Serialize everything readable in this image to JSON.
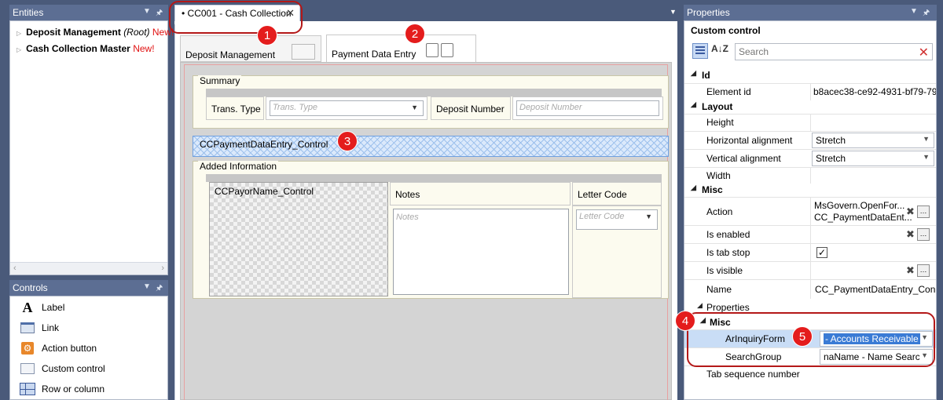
{
  "entities_panel": {
    "title": "Entities",
    "items": [
      {
        "name": "Deposit Management",
        "root": "(Root)",
        "new": "New!"
      },
      {
        "name": "Cash Collection Master",
        "root": "",
        "new": "New!"
      }
    ]
  },
  "controls_panel": {
    "title": "Controls",
    "items": [
      {
        "label": "Label",
        "icon": "label-icon"
      },
      {
        "label": "Link",
        "icon": "link-icon"
      },
      {
        "label": "Action button",
        "icon": "action-button-icon"
      },
      {
        "label": "Custom control",
        "icon": "custom-control-icon"
      },
      {
        "label": "Row or column",
        "icon": "row-column-icon"
      }
    ]
  },
  "document": {
    "tab_marker": "•",
    "tab_title": "CC001 - Cash Collection",
    "close_glyph": "✕"
  },
  "designer": {
    "tabs": [
      "Deposit Management",
      "Payment Data Entry"
    ],
    "summary_group": {
      "label": "Summary",
      "trans_type_label": "Trans. Type",
      "trans_type_placeholder": "Trans. Type",
      "deposit_number_label": "Deposit Number",
      "deposit_number_placeholder": "Deposit Number"
    },
    "payment_control_label": "CCPaymentDataEntry_Control",
    "added_info_group": {
      "label": "Added Information",
      "payor_control_label": "CCPayorName_Control",
      "notes_label": "Notes",
      "notes_placeholder": "Notes",
      "letter_code_label": "Letter Code",
      "letter_code_placeholder": "Letter Code"
    }
  },
  "properties_panel": {
    "title": "Properties",
    "subtitle": "Custom control",
    "search_placeholder": "Search",
    "sort_glyph": "A↓Z",
    "categories": {
      "id": "Id",
      "layout": "Layout",
      "misc": "Misc",
      "properties": "Properties",
      "misc2": "Misc"
    },
    "rows": {
      "element_id": {
        "name": "Element id",
        "value": "b8acec38-ce92-4931-bf79-79"
      },
      "height": {
        "name": "Height",
        "value": ""
      },
      "horizontal_alignment": {
        "name": "Horizontal alignment",
        "value": "Stretch"
      },
      "vertical_alignment": {
        "name": "Vertical alignment",
        "value": "Stretch"
      },
      "width": {
        "name": "Width",
        "value": ""
      },
      "action": {
        "name": "Action",
        "value_line1": "MsGovern.OpenFor...",
        "value_line2": "CC_PaymentDataEnt..."
      },
      "is_enabled": {
        "name": "Is enabled"
      },
      "is_tab_stop": {
        "name": "Is tab stop",
        "checked": true
      },
      "is_visible": {
        "name": "Is visible"
      },
      "name": {
        "name": "Name",
        "value": "CC_PaymentDataEntry_Con"
      },
      "ar_inquiry_form": {
        "name": "ArInquiryForm",
        "value": "- Accounts Receivable"
      },
      "search_group": {
        "name": "SearchGroup",
        "value": "naName - Name Searc"
      },
      "tab_sequence_number": {
        "name": "Tab sequence number"
      }
    }
  },
  "callouts": [
    "1",
    "2",
    "3",
    "4",
    "5"
  ],
  "colors": {
    "panel_header": "#5c6e93",
    "callout_red": "#e41c1c",
    "selection_blue": "#3a7bd5",
    "new_red": "#e01010"
  }
}
